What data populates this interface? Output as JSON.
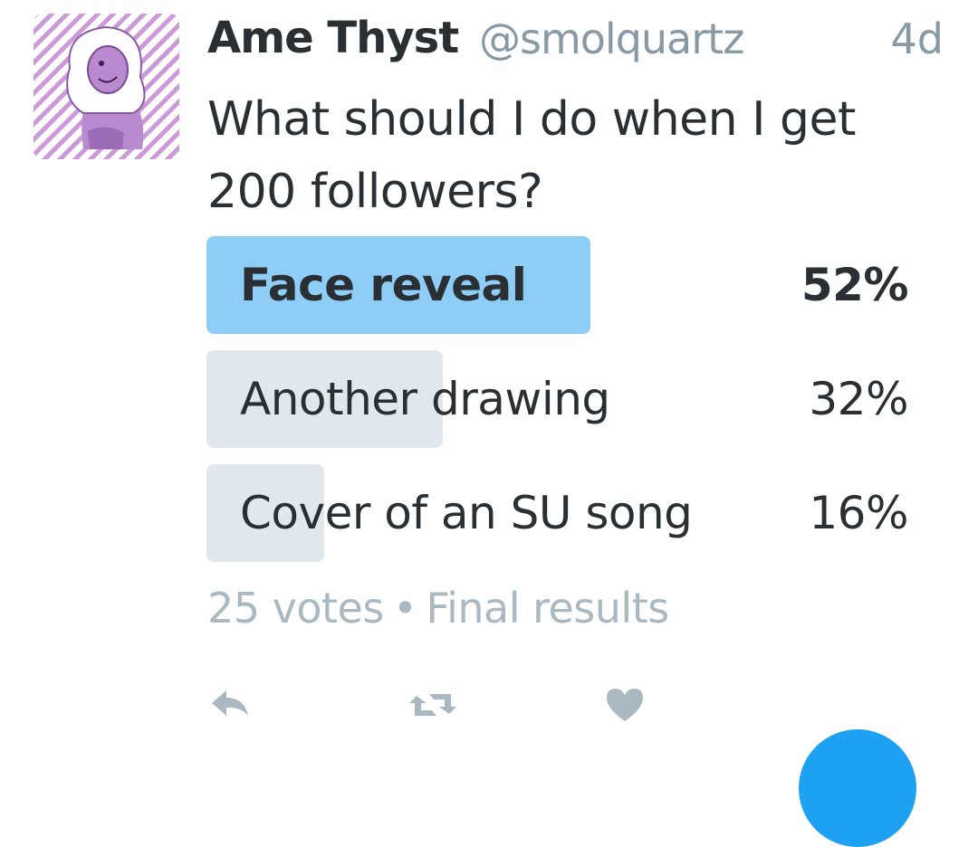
{
  "tweet": {
    "display_name": "Ame Thyst",
    "handle": "@smolquartz",
    "timestamp": "4d",
    "text": "What should I do when I get 200 followers?",
    "avatar_icon": "avatar-image"
  },
  "poll": {
    "options": [
      {
        "label": "Face reveal",
        "percent_text": "52%",
        "percent": 52,
        "winner": true
      },
      {
        "label": "Another drawing",
        "percent_text": "32%",
        "percent": 32,
        "winner": false
      },
      {
        "label": "Cover of an SU song",
        "percent_text": "16%",
        "percent": 16,
        "winner": false
      }
    ],
    "votes": "25 votes",
    "separator": "•",
    "status": "Final results"
  },
  "actions": {
    "reply_icon": "reply-icon",
    "retweet_icon": "retweet-icon",
    "like_icon": "heart-icon"
  },
  "colors": {
    "winner_bar": "#8dcdf6",
    "normal_bar": "#e1e8ed",
    "action_icon": "#aab8c2",
    "fab": "#1da1f2"
  }
}
